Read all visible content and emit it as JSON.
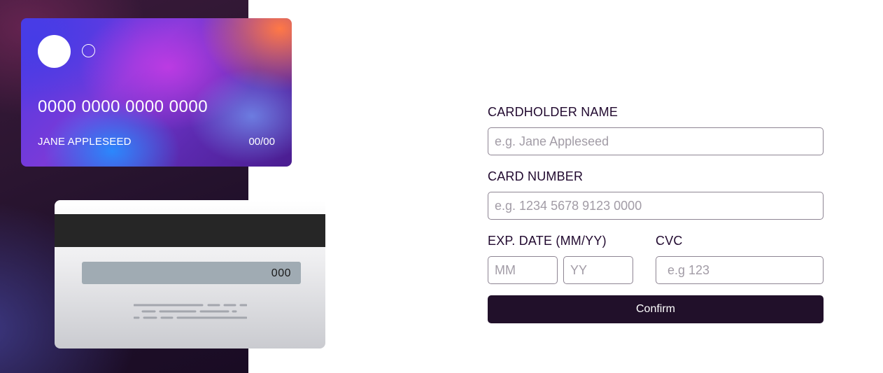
{
  "card_front": {
    "number": "0000 0000 0000 0000",
    "holder_name": "JANE APPLESEED",
    "expiry": "00/00"
  },
  "card_back": {
    "cvc": "000"
  },
  "form": {
    "cardholder_label": "CARDHOLDER NAME",
    "cardholder_placeholder": "e.g. Jane Appleseed",
    "cardholder_value": "",
    "card_number_label": "CARD NUMBER",
    "card_number_placeholder": "e.g. 1234 5678 9123 0000",
    "card_number_value": "",
    "exp_label": "EXP. DATE (MM/YY)",
    "month_placeholder": "MM",
    "month_value": "",
    "year_placeholder": "YY",
    "year_value": "",
    "cvc_label": "CVC",
    "cvc_placeholder": "e.g 123",
    "cvc_value": "",
    "confirm_label": "Confirm"
  },
  "colors": {
    "panel_dark": "#1f0f2a",
    "button_bg": "#21102a",
    "input_border": "#8e8593",
    "placeholder": "#a29ca6"
  },
  "icons": [
    "card-logo-filled-circle",
    "card-logo-outline-circle"
  ]
}
